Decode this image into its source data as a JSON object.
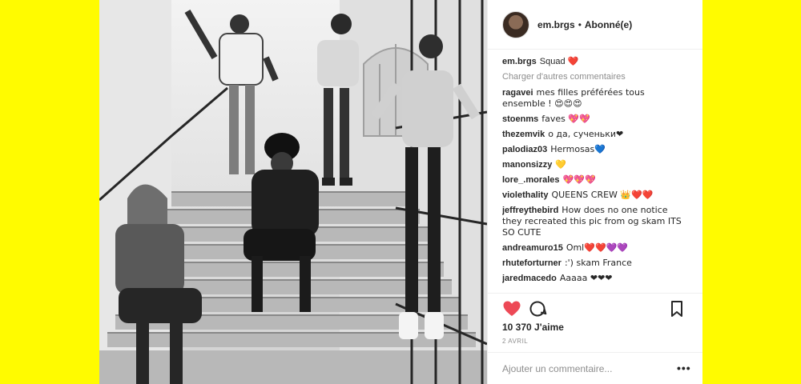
{
  "post": {
    "username": "em.brgs",
    "follow_status": "Abonné(e)",
    "caption_text": "Squad",
    "caption_emoji": "❤️",
    "load_more": "Charger d'autres commentaires",
    "likes": "10 370 J'aime",
    "date": "2 AVRIL",
    "comment_placeholder": "Ajouter un commentaire..."
  },
  "comments": [
    {
      "author": "ragavei",
      "text": "mes filles préférées tous ensemble ! 😍😍😍"
    },
    {
      "author": "stoenms",
      "text": "faves 💖💖"
    },
    {
      "author": "thezemvik",
      "text": "о да, сученьки❤"
    },
    {
      "author": "palodiaz03",
      "text": "Hermosas💙"
    },
    {
      "author": "manonsizzy",
      "text": "💛"
    },
    {
      "author": "lore_.morales",
      "text": "💖💖💖"
    },
    {
      "author": "violethality",
      "text": "QUEENS CREW 👑❤️❤️"
    },
    {
      "author": "jeffreythebird",
      "text": "How does no one notice they recreated this pic from og skam ITS SO CUTE"
    },
    {
      "author": "andreamuro15",
      "text": "Oml❤️❤️💜💜"
    },
    {
      "author": "rhuteforturner",
      "text": ":') skam France"
    },
    {
      "author": "jaredmacedo",
      "text": "Aaaaa ❤❤❤"
    }
  ],
  "icons": {
    "heart": "heart-icon",
    "comment": "comment-icon",
    "save": "bookmark-icon",
    "more": "more-icon"
  },
  "colors": {
    "background": "#fffb00",
    "heart": "#ed4956",
    "panel": "#ffffff",
    "text": "#262626",
    "muted": "#8e8e8e"
  }
}
